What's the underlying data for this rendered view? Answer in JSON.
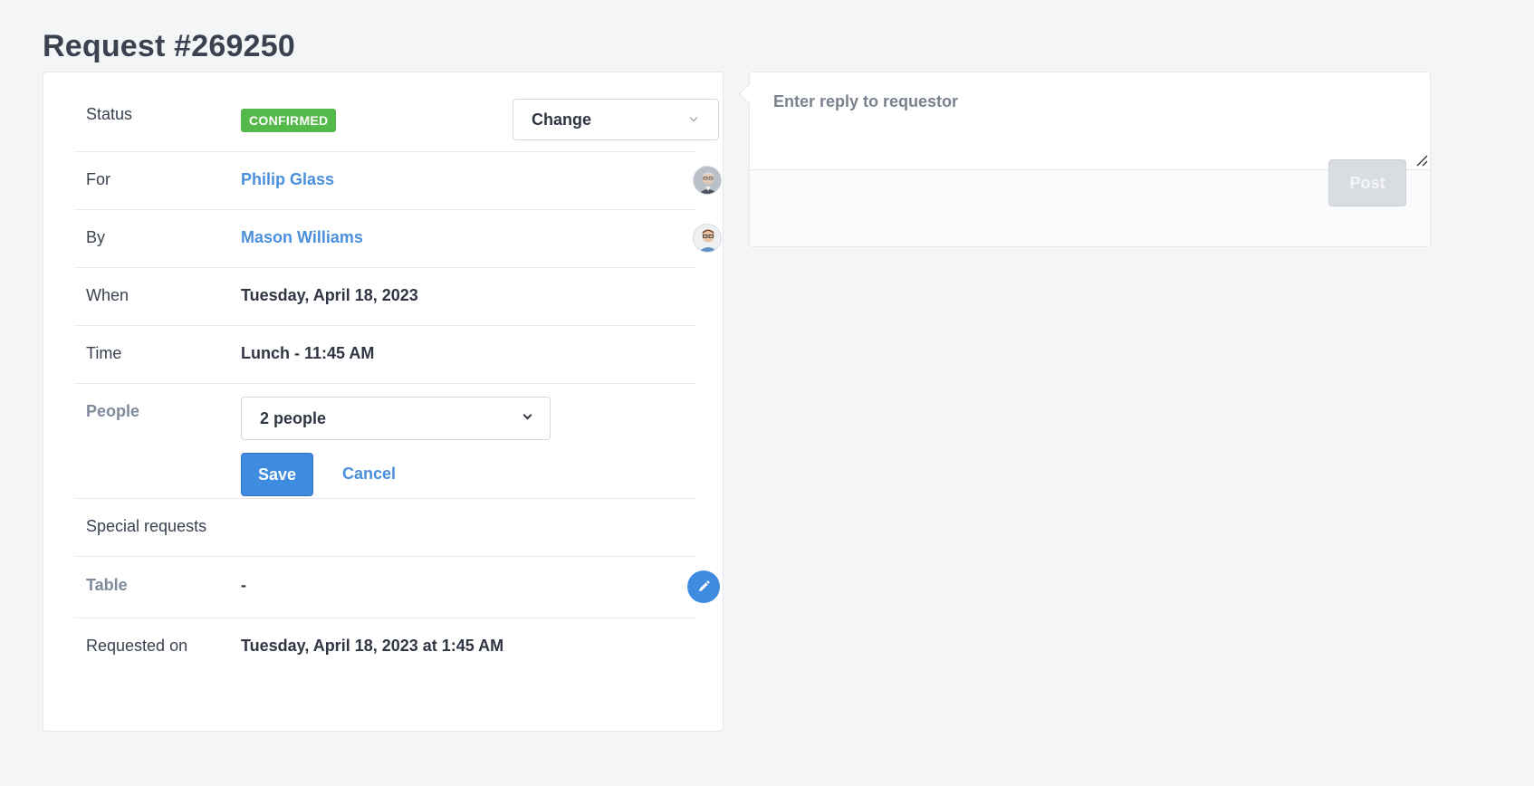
{
  "page": {
    "title": "Request #269250"
  },
  "details": {
    "status": {
      "label": "Status",
      "badge": "CONFIRMED",
      "badge_color": "#55b84a",
      "change_select": "Change"
    },
    "for": {
      "label": "For",
      "name": "Philip Glass"
    },
    "by": {
      "label": "By",
      "name": "Mason Williams"
    },
    "when": {
      "label": "When",
      "value": "Tuesday, April 18, 2023"
    },
    "time": {
      "label": "Time",
      "value": "Lunch - 11:45 AM"
    },
    "people": {
      "label": "People",
      "selected": "2 people",
      "save_label": "Save",
      "cancel_label": "Cancel"
    },
    "special_requests": {
      "label": "Special requests",
      "value": ""
    },
    "table": {
      "label": "Table",
      "value": "-",
      "edit_icon": "pencil-icon"
    },
    "requested_on": {
      "label": "Requested on",
      "value": "Tuesday, April 18, 2023 at 1:45 AM"
    }
  },
  "reply": {
    "placeholder": "Enter reply to requestor",
    "post_label": "Post"
  },
  "colors": {
    "accent": "#3f8be0",
    "link": "#4a8fdc",
    "confirmed": "#55b84a",
    "background": "#f4f5f7"
  }
}
